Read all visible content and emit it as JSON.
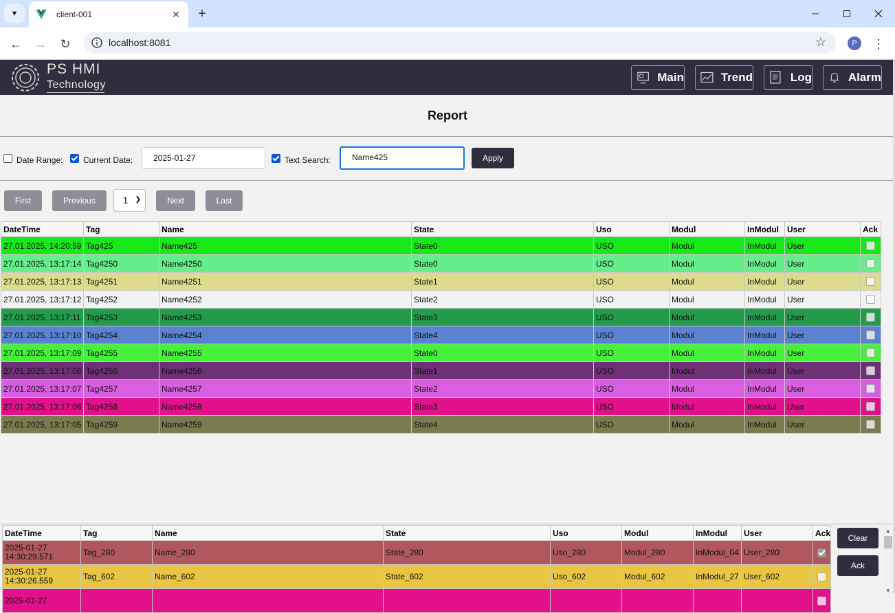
{
  "browser": {
    "tab_title": "client-001",
    "url": "localhost:8081",
    "profile_initial": "P"
  },
  "header": {
    "brand_line1": "PS HMI",
    "brand_line2": "Technology",
    "nav": [
      {
        "label": "Main",
        "icon": "monitor-icon"
      },
      {
        "label": "Trend",
        "icon": "chart-icon"
      },
      {
        "label": "Log",
        "icon": "log-icon"
      },
      {
        "label": "Alarm",
        "icon": "bell-icon"
      }
    ]
  },
  "page": {
    "title": "Report"
  },
  "filters": {
    "date_range_label": "Date Range:",
    "date_range_checked": false,
    "current_date_label": "Current Date:",
    "current_date_checked": true,
    "date_value": "2025-01-27",
    "text_search_label": "Text Search:",
    "text_search_checked": true,
    "search_value": "Name425",
    "apply_label": "Apply"
  },
  "pager": {
    "first": "First",
    "previous": "Previous",
    "page": "1",
    "next": "Next",
    "last": "Last"
  },
  "columns": [
    "DateTime",
    "Tag",
    "Name",
    "State",
    "Uso",
    "Modul",
    "InModul",
    "User",
    "Ack"
  ],
  "rows": [
    {
      "datetime": "27.01.2025, 14:20:59",
      "tag": "Tag425",
      "name": "Name425",
      "state": "State0",
      "uso": "USO",
      "modul": "Modul",
      "inmodul": "InModul",
      "user": "User",
      "color": "#17e817"
    },
    {
      "datetime": "27.01.2025, 13:17:14",
      "tag": "Tag4250",
      "name": "Name4250",
      "state": "State0",
      "uso": "USO",
      "modul": "Modul",
      "inmodul": "InModul",
      "user": "User",
      "color": "#66ee8a"
    },
    {
      "datetime": "27.01.2025, 13:17:13",
      "tag": "Tag4251",
      "name": "Name4251",
      "state": "State1",
      "uso": "USO",
      "modul": "Modul",
      "inmodul": "InModul",
      "user": "User",
      "color": "#dedc8c"
    },
    {
      "datetime": "27.01.2025, 13:17:12",
      "tag": "Tag4252",
      "name": "Name4252",
      "state": "State2",
      "uso": "USO",
      "modul": "Modul",
      "inmodul": "InModul",
      "user": "User",
      "color": "#f2f2f2"
    },
    {
      "datetime": "27.01.2025, 13:17:11",
      "tag": "Tag4253",
      "name": "Name4253",
      "state": "State3",
      "uso": "USO",
      "modul": "Modul",
      "inmodul": "InModul",
      "user": "User",
      "color": "#239b4b"
    },
    {
      "datetime": "27.01.2025, 13:17:10",
      "tag": "Tag4254",
      "name": "Name4254",
      "state": "State4",
      "uso": "USO",
      "modul": "Modul",
      "inmodul": "InModul",
      "user": "User",
      "color": "#5b82d0"
    },
    {
      "datetime": "27.01.2025, 13:17:09",
      "tag": "Tag4255",
      "name": "Name4255",
      "state": "State0",
      "uso": "USO",
      "modul": "Modul",
      "inmodul": "InModul",
      "user": "User",
      "color": "#47f03a"
    },
    {
      "datetime": "27.01.2025, 13:17:08",
      "tag": "Tag4256",
      "name": "Name4256",
      "state": "State1",
      "uso": "USO",
      "modul": "Modul",
      "inmodul": "InModul",
      "user": "User",
      "color": "#6f3077"
    },
    {
      "datetime": "27.01.2025, 13:17:07",
      "tag": "Tag4257",
      "name": "Name4257",
      "state": "State2",
      "uso": "USO",
      "modul": "Modul",
      "inmodul": "InModul",
      "user": "User",
      "color": "#d95ee0"
    },
    {
      "datetime": "27.01.2025, 13:17:06",
      "tag": "Tag4258",
      "name": "Name4258",
      "state": "State3",
      "uso": "USO",
      "modul": "Modul",
      "inmodul": "InModul",
      "user": "User",
      "color": "#e2108a"
    },
    {
      "datetime": "27.01.2025, 13:17:05",
      "tag": "Tag4259",
      "name": "Name4259",
      "state": "State4",
      "uso": "USO",
      "modul": "Modul",
      "inmodul": "InModul",
      "user": "User",
      "color": "#7a7b4e"
    }
  ],
  "alarms": {
    "rows": [
      {
        "date": "2025-01-27",
        "time": "14:30:29.571",
        "tag": "Tag_280",
        "name": "Name_280",
        "state": "State_280",
        "uso": "Uso_280",
        "modul": "Modul_280",
        "inmodul": "InModul_04",
        "user": "User_280",
        "acked": true,
        "color": "#b0585e"
      },
      {
        "date": "2025-01-27",
        "time": "14:30:26.559",
        "tag": "Tag_602",
        "name": "Name_602",
        "state": "State_602",
        "uso": "Uso_602",
        "modul": "Modul_602",
        "inmodul": "InModul_27",
        "user": "User_602",
        "acked": false,
        "color": "#e8c542"
      },
      {
        "date": "2025-01-27",
        "time": "",
        "tag": "",
        "name": "",
        "state": "",
        "uso": "",
        "modul": "",
        "inmodul": "",
        "user": "",
        "acked": false,
        "color": "#e2108a"
      }
    ],
    "clear_label": "Clear",
    "ack_label": "Ack"
  }
}
